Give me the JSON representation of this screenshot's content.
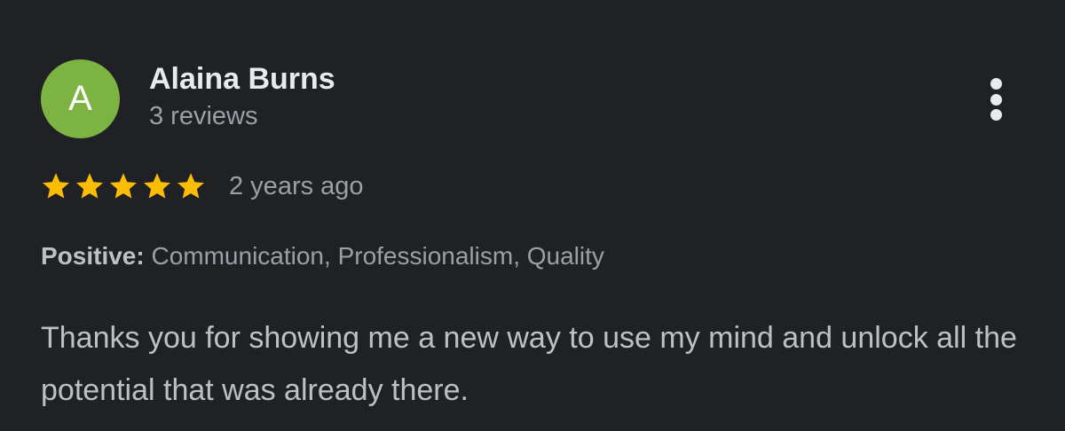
{
  "author": {
    "initial": "A",
    "name": "Alaina Burns",
    "review_count": "3 reviews"
  },
  "rating": {
    "stars": 5,
    "max_stars": 5,
    "time_ago": "2 years ago"
  },
  "attributes": {
    "label": "Positive:",
    "values": "Communication, Professionalism, Quality"
  },
  "review": {
    "text": "Thanks you for showing me a new way to use my mind and unlock all the potential that was already there."
  },
  "icons": {
    "more": "more-vert-icon",
    "star": "star-icon"
  },
  "colors": {
    "background": "#202124",
    "avatar": "#7cb342",
    "star": "#fbbc04",
    "primary_text": "#e8eaed",
    "secondary_text": "#9aa0a6"
  }
}
